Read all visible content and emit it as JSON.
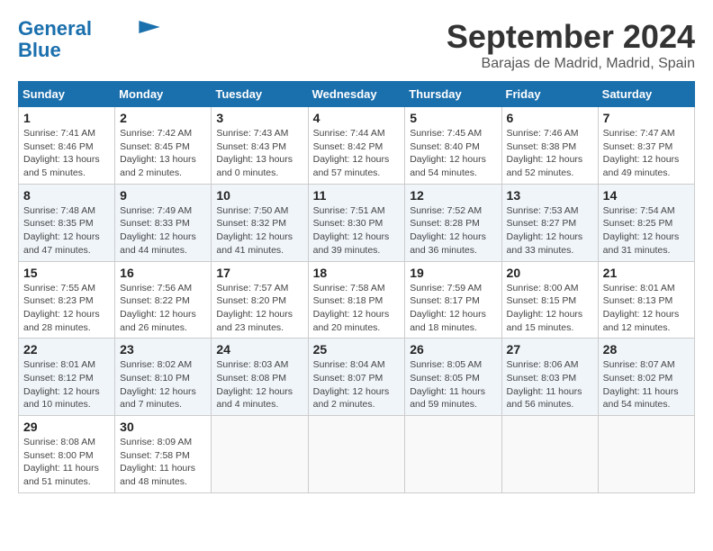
{
  "logo": {
    "line1": "General",
    "line2": "Blue"
  },
  "title": "September 2024",
  "subtitle": "Barajas de Madrid, Madrid, Spain",
  "days_header": [
    "Sunday",
    "Monday",
    "Tuesday",
    "Wednesday",
    "Thursday",
    "Friday",
    "Saturday"
  ],
  "weeks": [
    [
      {
        "num": "1",
        "info": "Sunrise: 7:41 AM\nSunset: 8:46 PM\nDaylight: 13 hours\nand 5 minutes."
      },
      {
        "num": "2",
        "info": "Sunrise: 7:42 AM\nSunset: 8:45 PM\nDaylight: 13 hours\nand 2 minutes."
      },
      {
        "num": "3",
        "info": "Sunrise: 7:43 AM\nSunset: 8:43 PM\nDaylight: 13 hours\nand 0 minutes."
      },
      {
        "num": "4",
        "info": "Sunrise: 7:44 AM\nSunset: 8:42 PM\nDaylight: 12 hours\nand 57 minutes."
      },
      {
        "num": "5",
        "info": "Sunrise: 7:45 AM\nSunset: 8:40 PM\nDaylight: 12 hours\nand 54 minutes."
      },
      {
        "num": "6",
        "info": "Sunrise: 7:46 AM\nSunset: 8:38 PM\nDaylight: 12 hours\nand 52 minutes."
      },
      {
        "num": "7",
        "info": "Sunrise: 7:47 AM\nSunset: 8:37 PM\nDaylight: 12 hours\nand 49 minutes."
      }
    ],
    [
      {
        "num": "8",
        "info": "Sunrise: 7:48 AM\nSunset: 8:35 PM\nDaylight: 12 hours\nand 47 minutes."
      },
      {
        "num": "9",
        "info": "Sunrise: 7:49 AM\nSunset: 8:33 PM\nDaylight: 12 hours\nand 44 minutes."
      },
      {
        "num": "10",
        "info": "Sunrise: 7:50 AM\nSunset: 8:32 PM\nDaylight: 12 hours\nand 41 minutes."
      },
      {
        "num": "11",
        "info": "Sunrise: 7:51 AM\nSunset: 8:30 PM\nDaylight: 12 hours\nand 39 minutes."
      },
      {
        "num": "12",
        "info": "Sunrise: 7:52 AM\nSunset: 8:28 PM\nDaylight: 12 hours\nand 36 minutes."
      },
      {
        "num": "13",
        "info": "Sunrise: 7:53 AM\nSunset: 8:27 PM\nDaylight: 12 hours\nand 33 minutes."
      },
      {
        "num": "14",
        "info": "Sunrise: 7:54 AM\nSunset: 8:25 PM\nDaylight: 12 hours\nand 31 minutes."
      }
    ],
    [
      {
        "num": "15",
        "info": "Sunrise: 7:55 AM\nSunset: 8:23 PM\nDaylight: 12 hours\nand 28 minutes."
      },
      {
        "num": "16",
        "info": "Sunrise: 7:56 AM\nSunset: 8:22 PM\nDaylight: 12 hours\nand 26 minutes."
      },
      {
        "num": "17",
        "info": "Sunrise: 7:57 AM\nSunset: 8:20 PM\nDaylight: 12 hours\nand 23 minutes."
      },
      {
        "num": "18",
        "info": "Sunrise: 7:58 AM\nSunset: 8:18 PM\nDaylight: 12 hours\nand 20 minutes."
      },
      {
        "num": "19",
        "info": "Sunrise: 7:59 AM\nSunset: 8:17 PM\nDaylight: 12 hours\nand 18 minutes."
      },
      {
        "num": "20",
        "info": "Sunrise: 8:00 AM\nSunset: 8:15 PM\nDaylight: 12 hours\nand 15 minutes."
      },
      {
        "num": "21",
        "info": "Sunrise: 8:01 AM\nSunset: 8:13 PM\nDaylight: 12 hours\nand 12 minutes."
      }
    ],
    [
      {
        "num": "22",
        "info": "Sunrise: 8:01 AM\nSunset: 8:12 PM\nDaylight: 12 hours\nand 10 minutes."
      },
      {
        "num": "23",
        "info": "Sunrise: 8:02 AM\nSunset: 8:10 PM\nDaylight: 12 hours\nand 7 minutes."
      },
      {
        "num": "24",
        "info": "Sunrise: 8:03 AM\nSunset: 8:08 PM\nDaylight: 12 hours\nand 4 minutes."
      },
      {
        "num": "25",
        "info": "Sunrise: 8:04 AM\nSunset: 8:07 PM\nDaylight: 12 hours\nand 2 minutes."
      },
      {
        "num": "26",
        "info": "Sunrise: 8:05 AM\nSunset: 8:05 PM\nDaylight: 11 hours\nand 59 minutes."
      },
      {
        "num": "27",
        "info": "Sunrise: 8:06 AM\nSunset: 8:03 PM\nDaylight: 11 hours\nand 56 minutes."
      },
      {
        "num": "28",
        "info": "Sunrise: 8:07 AM\nSunset: 8:02 PM\nDaylight: 11 hours\nand 54 minutes."
      }
    ],
    [
      {
        "num": "29",
        "info": "Sunrise: 8:08 AM\nSunset: 8:00 PM\nDaylight: 11 hours\nand 51 minutes."
      },
      {
        "num": "30",
        "info": "Sunrise: 8:09 AM\nSunset: 7:58 PM\nDaylight: 11 hours\nand 48 minutes."
      },
      null,
      null,
      null,
      null,
      null
    ]
  ]
}
